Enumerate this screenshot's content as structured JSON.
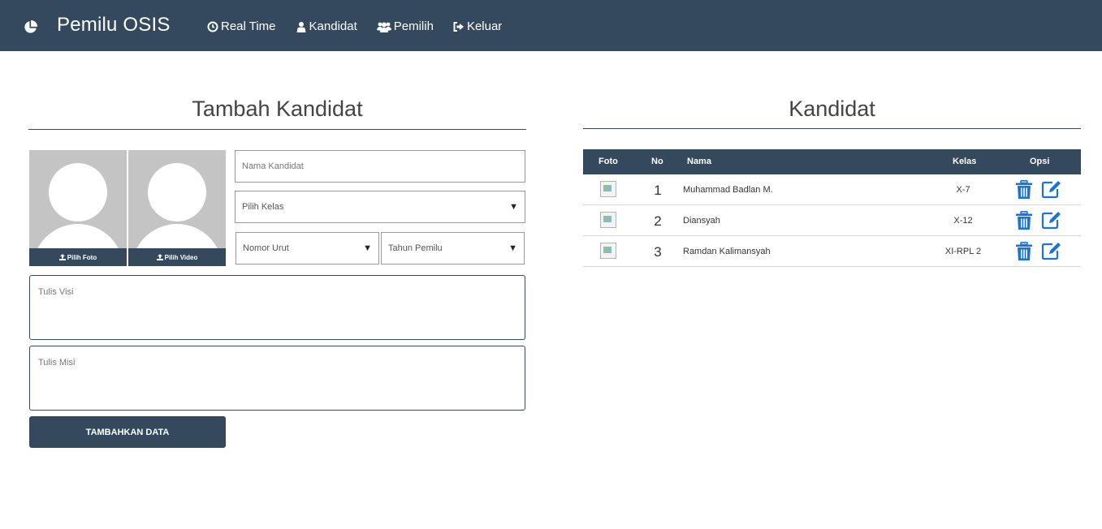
{
  "navbar": {
    "brand": "Pemilu OSIS",
    "brand_icon": "pie-chart-icon",
    "items": [
      {
        "label": "Real Time",
        "icon": "clock-icon"
      },
      {
        "label": "Kandidat",
        "icon": "user-icon"
      },
      {
        "label": "Pemilih",
        "icon": "users-icon"
      },
      {
        "label": "Keluar",
        "icon": "sign-out-icon"
      }
    ]
  },
  "form": {
    "title": "Tambah Kandidat",
    "photo_button": "Pilih Foto",
    "video_button": "Pilih Video",
    "name_placeholder": "Nama Kandidat",
    "class_select": "Pilih Kelas",
    "number_select": "Nomor Urut",
    "year_select": "Tahun Pemilu",
    "vision_placeholder": "Tulis Visi",
    "mission_placeholder": "Tulis Misi",
    "submit_label": "TAMBAHKAN DATA"
  },
  "table": {
    "title": "Kandidat",
    "headers": {
      "foto": "Foto",
      "no": "No",
      "nama": "Nama",
      "kelas": "Kelas",
      "opsi": "Opsi"
    },
    "rows": [
      {
        "no": "1",
        "nama": "Muhammad Badlan M.",
        "kelas": "X-7"
      },
      {
        "no": "2",
        "nama": "Diansyah",
        "kelas": "X-12"
      },
      {
        "no": "3",
        "nama": "Ramdan Kalimansyah",
        "kelas": "XI-RPL 2"
      }
    ]
  },
  "colors": {
    "primary": "#34495e",
    "action_blue": "#1a73d9"
  }
}
